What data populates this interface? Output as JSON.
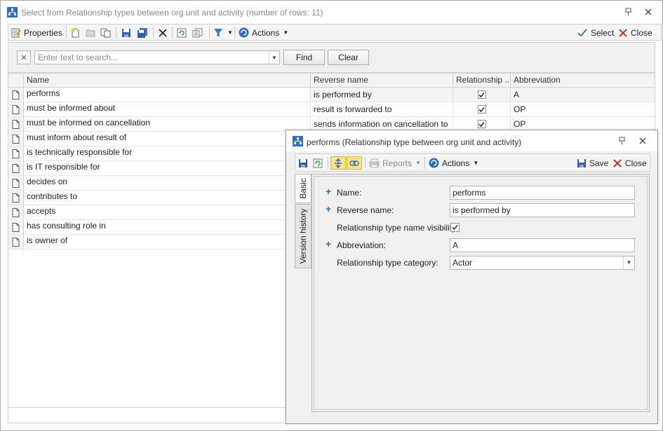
{
  "window": {
    "title": "Select from Relationship types between org unit and activity (number of rows: 11)"
  },
  "toolbar": {
    "properties_label": "Properties",
    "actions_label": "Actions",
    "select_label": "Select",
    "close_label": "Close"
  },
  "search": {
    "placeholder": "Enter text to search...",
    "find_label": "Find",
    "clear_label": "Clear"
  },
  "grid": {
    "columns": [
      "Name",
      "Reverse name",
      "Relationship ...",
      "Abbreviation"
    ],
    "rows": [
      {
        "name": "performs",
        "reverse": "is performed by",
        "visible": true,
        "abbr": "A"
      },
      {
        "name": "must be informed about",
        "reverse": "result is forwarded to",
        "visible": true,
        "abbr": "OP"
      },
      {
        "name": "must be informed on cancellation",
        "reverse": "sends information on cancellation to",
        "visible": true,
        "abbr": "OP"
      },
      {
        "name": "must inform about result of",
        "reverse": "",
        "visible": false,
        "abbr": ""
      },
      {
        "name": "is technically responsible for",
        "reverse": "",
        "visible": false,
        "abbr": ""
      },
      {
        "name": "is IT responsible for",
        "reverse": "",
        "visible": false,
        "abbr": ""
      },
      {
        "name": "decides on",
        "reverse": "",
        "visible": false,
        "abbr": ""
      },
      {
        "name": "contributes to",
        "reverse": "",
        "visible": false,
        "abbr": ""
      },
      {
        "name": "accepts",
        "reverse": "",
        "visible": false,
        "abbr": ""
      },
      {
        "name": "has consulting role in",
        "reverse": "",
        "visible": false,
        "abbr": ""
      },
      {
        "name": "is owner of",
        "reverse": "",
        "visible": false,
        "abbr": ""
      }
    ]
  },
  "dialog": {
    "title": "performs (Relationship type between org unit and activity)",
    "reports_label": "Reports",
    "actions_label": "Actions",
    "save_label": "Save",
    "close_label": "Close",
    "tabs": [
      "Basic",
      "Version history"
    ],
    "fields": {
      "name_label": "Name:",
      "name_value": "performs",
      "reverse_label": "Reverse name:",
      "reverse_value": "is performed by",
      "visibility_label": "Relationship type name visibility:",
      "abbr_label": "Abbreviation:",
      "abbr_value": "A",
      "category_label": "Relationship type category:",
      "category_value": "Actor"
    }
  },
  "colors": {
    "accent_blue": "#2f6fb7",
    "red_x": "#c8321e",
    "pressed_bg": "#fbe38a"
  }
}
